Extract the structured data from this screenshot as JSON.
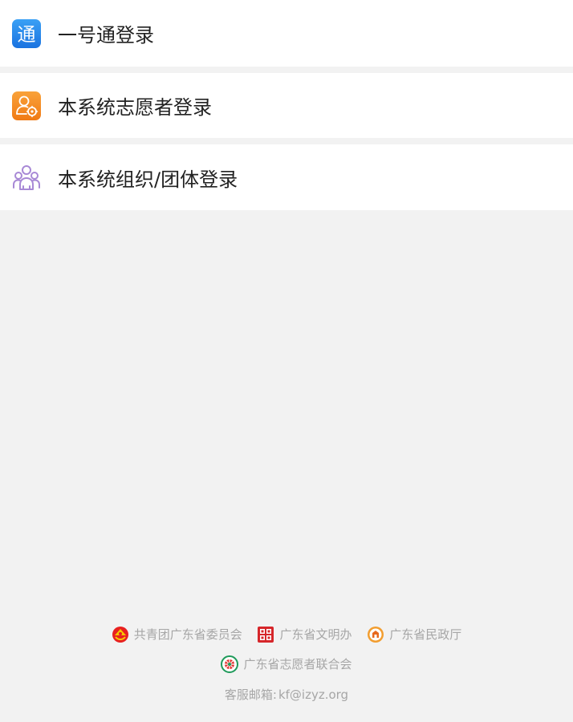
{
  "login_options": [
    {
      "label": "一号通登录",
      "icon": "tong-icon",
      "color": "#1e88e5"
    },
    {
      "label": "本系统志愿者登录",
      "icon": "volunteer-user-icon",
      "color": "#f5841f"
    },
    {
      "label": "本系统组织/团体登录",
      "icon": "group-icon",
      "color": "#a889d6"
    }
  ],
  "icon_glyphs": {
    "tong": "通"
  },
  "footer": {
    "orgs": [
      {
        "name": "共青团广东省委员会",
        "icon": "youth-league-emblem-icon"
      },
      {
        "name": "广东省文明办",
        "icon": "civilization-office-icon"
      },
      {
        "name": "广东省民政厅",
        "icon": "civil-affairs-emblem-icon"
      },
      {
        "name": "广东省志愿者联合会",
        "icon": "volunteer-federation-icon"
      }
    ],
    "contact_label": "客服邮箱:",
    "contact_email": "kf@izyz.org"
  },
  "colors": {
    "background": "#f2f2f2",
    "row_background": "#ffffff",
    "label_text": "#222222",
    "footer_text": "#a6a6a6"
  }
}
